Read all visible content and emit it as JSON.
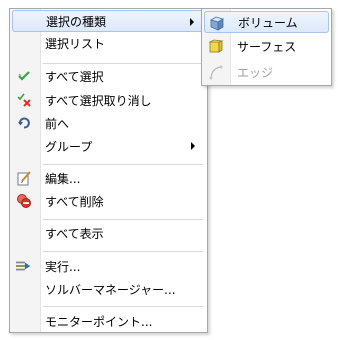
{
  "menu": {
    "items": [
      {
        "label": "選択の種類",
        "icon": "none",
        "has_submenu": true
      },
      {
        "label": "選択リスト",
        "icon": "none"
      },
      {
        "label": "すべて選択",
        "icon": "check-icon"
      },
      {
        "label": "すべて選択取り消し",
        "icon": "deselect-icon"
      },
      {
        "label": "前へ",
        "icon": "previous-icon"
      },
      {
        "label": "グループ",
        "icon": "none",
        "has_submenu": true
      },
      {
        "label": "編集...",
        "icon": "edit-icon"
      },
      {
        "label": "すべて削除",
        "icon": "delete-all-icon"
      },
      {
        "label": "すべて表示",
        "icon": "none"
      },
      {
        "label": "実行...",
        "icon": "run-icon"
      },
      {
        "label": "ソルバーマネージャー...",
        "icon": "none"
      },
      {
        "label": "モニターポイント...",
        "icon": "none"
      }
    ]
  },
  "submenu": {
    "items": [
      {
        "label": "ボリューム",
        "icon": "volume-cube-icon"
      },
      {
        "label": "サーフェス",
        "icon": "surface-icon"
      },
      {
        "label": "エッジ",
        "icon": "edge-icon",
        "disabled": true
      }
    ]
  },
  "colors": {
    "highlight_border": "#a9c3ea",
    "check_green": "#3aa34a",
    "delete_red": "#d9342b",
    "disabled_text": "#a0a0a0"
  }
}
